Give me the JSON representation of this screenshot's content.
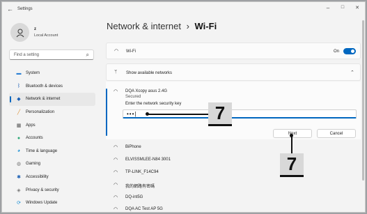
{
  "titlebar": {
    "back_icon": "back-arrow-icon",
    "title": "Settings",
    "minimize": "–",
    "maximize": "□",
    "close": "✕"
  },
  "user": {
    "name": "z",
    "account": "Local Account"
  },
  "search": {
    "placeholder": "Find a setting"
  },
  "sidebar": {
    "items": [
      {
        "label": "System",
        "icon": "monitor-icon",
        "active": false
      },
      {
        "label": "Bluetooth & devices",
        "icon": "bluetooth-icon",
        "active": false
      },
      {
        "label": "Network & internet",
        "icon": "wifi-icon",
        "active": true
      },
      {
        "label": "Personalization",
        "icon": "brush-icon",
        "active": false
      },
      {
        "label": "Apps",
        "icon": "apps-icon",
        "active": false
      },
      {
        "label": "Accounts",
        "icon": "person-icon",
        "active": false
      },
      {
        "label": "Time & language",
        "icon": "globe-clock-icon",
        "active": false
      },
      {
        "label": "Gaming",
        "icon": "controller-icon",
        "active": false
      },
      {
        "label": "Accessibility",
        "icon": "accessibility-icon",
        "active": false
      },
      {
        "label": "Privacy & security",
        "icon": "shield-icon",
        "active": false
      },
      {
        "label": "Windows Update",
        "icon": "update-icon",
        "active": false
      }
    ]
  },
  "breadcrumb": {
    "parent": "Network & internet",
    "separator": "›",
    "current": "Wi-Fi"
  },
  "wifi_row": {
    "label": "Wi-Fi",
    "state": "On"
  },
  "networks_row": {
    "label": "Show available networks"
  },
  "connecting": {
    "ssid": "DQA Xcopy asus 2.4G",
    "status": "Secured",
    "prompt": "Enter the network security key",
    "key_value": "•••|",
    "next": "Next",
    "cancel": "Cancel"
  },
  "networks": [
    "BiPhone",
    "ELVISSMLEE-N84 3001",
    "TP-LINK_F14C94",
    "我的網路有密碼",
    "DQ-int5G",
    "DQA AC Test AP 5G"
  ],
  "callouts": [
    "7",
    "7"
  ],
  "colors": {
    "accent": "#0067c0",
    "window_bg": "#f3f3f3",
    "card_bg": "#fbfbfb"
  }
}
